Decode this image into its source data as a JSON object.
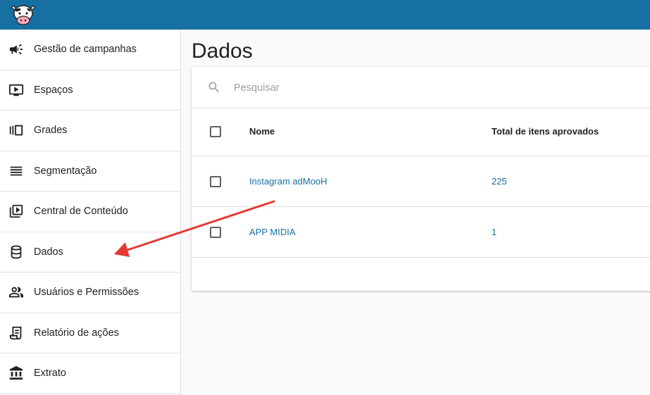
{
  "colors": {
    "topbar": "#1670a2",
    "link": "#1670a2",
    "arrow": "#e53935"
  },
  "topbar": {
    "logo_icon": "cow-logo"
  },
  "sidebar": {
    "items": [
      {
        "label": "Gestão de campanhas",
        "icon": "megaphone-icon"
      },
      {
        "label": "Espaços",
        "icon": "tv-play-icon"
      },
      {
        "label": "Grades",
        "icon": "carousel-icon"
      },
      {
        "label": "Segmentação",
        "icon": "lines-icon"
      },
      {
        "label": "Central de Conteúdo",
        "icon": "video-library-icon"
      },
      {
        "label": "Dados",
        "icon": "database-icon"
      },
      {
        "label": "Usuários e Permissões",
        "icon": "people-icon"
      },
      {
        "label": "Relatório de ações",
        "icon": "report-icon"
      },
      {
        "label": "Extrato",
        "icon": "bank-icon"
      }
    ]
  },
  "main": {
    "title": "Dados",
    "search": {
      "placeholder": "Pesquisar",
      "value": ""
    },
    "table": {
      "headers": {
        "name": "Nome",
        "total": "Total de itens aprovados"
      },
      "rows": [
        {
          "name": "Instagram adMooH",
          "total": "225"
        },
        {
          "name": "APP MIDIA",
          "total": "1"
        }
      ]
    }
  }
}
